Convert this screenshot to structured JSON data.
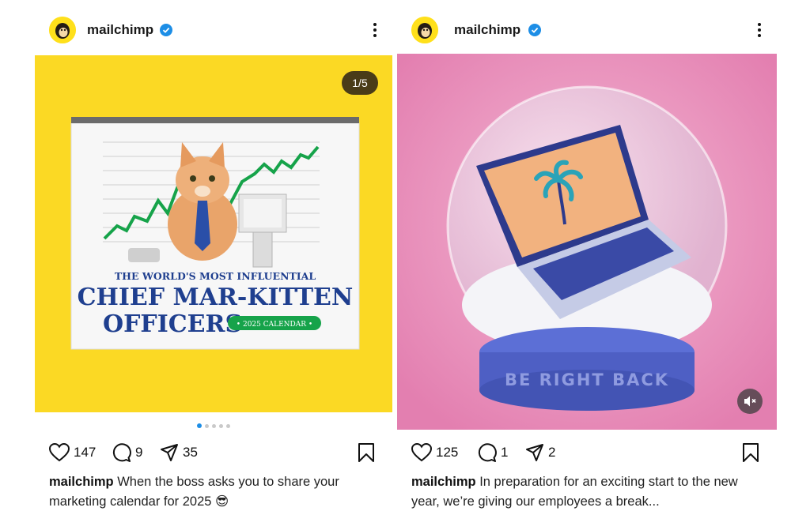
{
  "posts": [
    {
      "username": "mailchimp",
      "slide_counter": "1/5",
      "artwork": {
        "line1": "THE WORLD'S MOST INFLUENTIAL",
        "line2": "CHIEF MAR-KITTEN",
        "line3": "OFFICERS",
        "badge": "• 2025 CALENDAR •"
      },
      "likes": "147",
      "comments": "9",
      "shares": "35",
      "caption_user": "mailchimp",
      "caption_text": "When the boss asks you to share your marketing calendar for 2025 😎",
      "carousel": {
        "total": 5,
        "active": 0
      }
    },
    {
      "username": "mailchimp",
      "artwork": {
        "base_text": "BE RIGHT BACK"
      },
      "likes": "125",
      "comments": "1",
      "shares": "2",
      "caption_user": "mailchimp",
      "caption_text": "In preparation for an exciting start to the new year, we’re giving our employees a break..."
    }
  ],
  "colors": {
    "brand_yellow": "#fbd924",
    "verified_blue": "#1d8ee6",
    "pink_background": "#e88ab7",
    "calendar_navy": "#1f3f8f",
    "chart_green": "#16a34a"
  },
  "icons": [
    "more-options-icon",
    "heart-icon",
    "comment-icon",
    "share-icon",
    "bookmark-icon",
    "verified-badge-icon",
    "mute-icon"
  ]
}
